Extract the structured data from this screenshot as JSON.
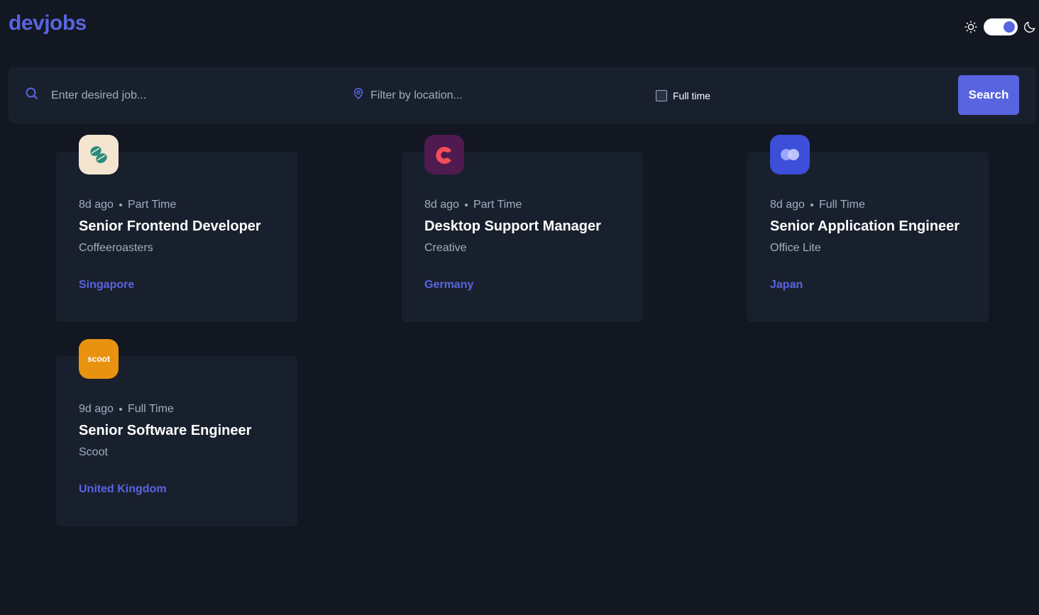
{
  "app": {
    "logo": "devjobs"
  },
  "theme": {
    "light_icon": "sun-icon",
    "dark_icon": "moon-icon",
    "mode": "dark"
  },
  "search": {
    "job_placeholder": "Enter desired job...",
    "job_value": "",
    "location_placeholder": "Filter by location...",
    "location_value": "",
    "fulltime_label": "Full time",
    "fulltime_checked": false,
    "button_label": "Search"
  },
  "colors": {
    "accent": "#5964e0",
    "background": "#121721",
    "card": "#19202d",
    "muted_text": "#9daec2"
  },
  "jobs": [
    {
      "posted": "8d ago",
      "contract": "Part Time",
      "position": "Senior Frontend Developer",
      "company": "Coffeeroasters",
      "location": "Singapore",
      "logo_icon": "coffeeroasters-logo-icon",
      "logo_bg": "#f4e5d0"
    },
    {
      "posted": "8d ago",
      "contract": "Part Time",
      "position": "Desktop Support Manager",
      "company": "Creative",
      "location": "Germany",
      "logo_icon": "creative-logo-icon",
      "logo_bg": "#4e1a4f"
    },
    {
      "posted": "8d ago",
      "contract": "Full Time",
      "position": "Senior Application Engineer",
      "company": "Office Lite",
      "location": "Japan",
      "logo_icon": "officelite-logo-icon",
      "logo_bg": "#3d4ed8"
    },
    {
      "posted": "9d ago",
      "contract": "Full Time",
      "position": "Senior Software Engineer",
      "company": "Scoot",
      "location": "United Kingdom",
      "logo_icon": "scoot-logo-icon",
      "logo_bg": "#e99210",
      "logo_text": "scoot"
    }
  ]
}
